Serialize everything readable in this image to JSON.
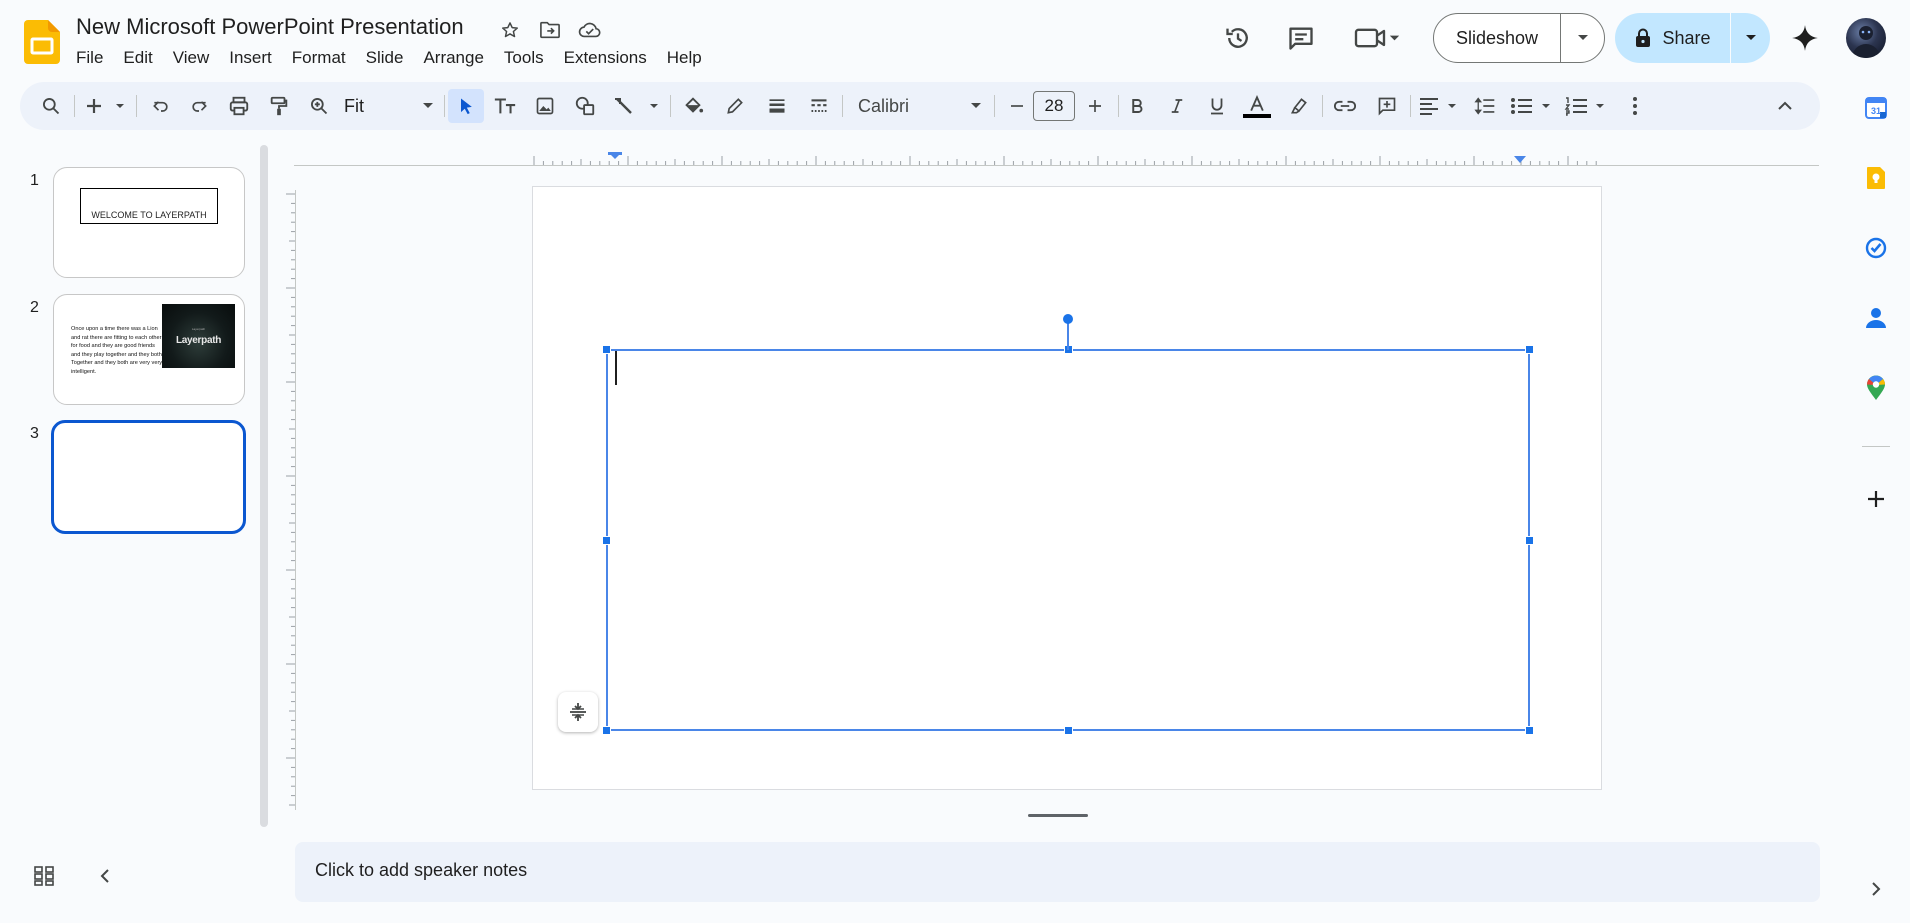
{
  "header": {
    "title": "New Microsoft PowerPoint Presentation",
    "icons": [
      "star-icon",
      "move-folder-icon",
      "cloud-saved-icon"
    ]
  },
  "menu": [
    "File",
    "Edit",
    "View",
    "Insert",
    "Format",
    "Slide",
    "Arrange",
    "Tools",
    "Extensions",
    "Help"
  ],
  "actions": {
    "slideshow_label": "Slideshow",
    "share_label": "Share"
  },
  "toolbar": {
    "zoom": "Fit",
    "font": "Calibri",
    "font_size": "28"
  },
  "slides": [
    {
      "number": "1",
      "title": "WELCOME TO LAYERPATH"
    },
    {
      "number": "2",
      "text": "Once upon a time there was a Lion and rat there are fitting to each other for food and they are good friends and they play together and they both Together and they both are very very intelligent.",
      "image_text": "Layerpath",
      "image_small": "Layerpath"
    },
    {
      "number": "3"
    }
  ],
  "notes": {
    "placeholder": "Click to add speaker notes"
  },
  "colors": {
    "accent": "#0b57d0",
    "selection": "#4a86e8",
    "share_bg": "#c2e7ff",
    "toolbar_bg": "#edf2fa",
    "logo": "#fbbc04"
  }
}
